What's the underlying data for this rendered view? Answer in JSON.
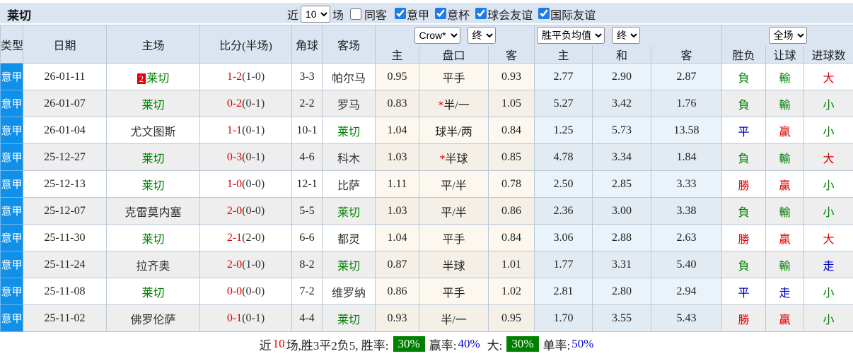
{
  "colors": {
    "red": "#dd0000",
    "green": "#008000",
    "blue": "#0000cc",
    "league_bg": "#1190ea",
    "header_bg": "#dbe5f1"
  },
  "topbar": {
    "team": "莱切",
    "near_label": "近",
    "near_count": "10",
    "games_label": "场",
    "same_away_label": "同客",
    "leagues": [
      {
        "label": "意甲",
        "checked": true
      },
      {
        "label": "意杯",
        "checked": true
      },
      {
        "label": "球会友谊",
        "checked": true
      },
      {
        "label": "国际友谊",
        "checked": true
      }
    ]
  },
  "header": {
    "cols": [
      "类型",
      "日期",
      "主场",
      "比分(半场)",
      "角球",
      "客场"
    ],
    "sub": [
      "主",
      "盘口",
      "客",
      "主",
      "和",
      "客",
      "胜负",
      "让球",
      "进球数"
    ],
    "selects": {
      "asia_company": "Crow*",
      "asia_time": "终",
      "europe_type": "胜平负均值",
      "europe_time": "终",
      "scope": "全场"
    }
  },
  "rows": [
    {
      "league": "意甲",
      "date": "26-01-11",
      "home": {
        "badge": "2",
        "name": "莱切",
        "lecce": true
      },
      "ft": "1-2",
      "ht": "(1-0)",
      "corner": "3-3",
      "away": {
        "name": "帕尔马",
        "lecce": false
      },
      "a_home": "0.95",
      "star": false,
      "hcap": "平手",
      "a_away": "0.93",
      "e_home": "2.77",
      "e_draw": "2.90",
      "e_away": "2.87",
      "outcome": {
        "t": "負",
        "c": "green"
      },
      "hres": {
        "t": "輸",
        "c": "green"
      },
      "goals": {
        "t": "大",
        "c": "red"
      }
    },
    {
      "league": "意甲",
      "date": "26-01-07",
      "home": {
        "badge": "",
        "name": "莱切",
        "lecce": true
      },
      "ft": "0-2",
      "ht": "(0-1)",
      "corner": "2-2",
      "away": {
        "name": "罗马",
        "lecce": false
      },
      "a_home": "0.83",
      "star": true,
      "hcap": "半/一",
      "a_away": "1.05",
      "e_home": "5.27",
      "e_draw": "3.42",
      "e_away": "1.76",
      "outcome": {
        "t": "負",
        "c": "green"
      },
      "hres": {
        "t": "輸",
        "c": "green"
      },
      "goals": {
        "t": "小",
        "c": "green"
      }
    },
    {
      "league": "意甲",
      "date": "26-01-04",
      "home": {
        "badge": "",
        "name": "尤文图斯",
        "lecce": false
      },
      "ft": "1-1",
      "ht": "(0-1)",
      "corner": "10-1",
      "away": {
        "name": "莱切",
        "lecce": true
      },
      "a_home": "1.04",
      "star": false,
      "hcap": "球半/两",
      "a_away": "0.84",
      "e_home": "1.25",
      "e_draw": "5.73",
      "e_away": "13.58",
      "outcome": {
        "t": "平",
        "c": "blue"
      },
      "hres": {
        "t": "贏",
        "c": "red"
      },
      "goals": {
        "t": "小",
        "c": "green"
      }
    },
    {
      "league": "意甲",
      "date": "25-12-27",
      "home": {
        "badge": "",
        "name": "莱切",
        "lecce": true
      },
      "ft": "0-3",
      "ht": "(0-1)",
      "corner": "4-6",
      "away": {
        "name": "科木",
        "lecce": false
      },
      "a_home": "1.03",
      "star": true,
      "hcap": "半球",
      "a_away": "0.85",
      "e_home": "4.78",
      "e_draw": "3.34",
      "e_away": "1.84",
      "outcome": {
        "t": "負",
        "c": "green"
      },
      "hres": {
        "t": "輸",
        "c": "green"
      },
      "goals": {
        "t": "大",
        "c": "red"
      }
    },
    {
      "league": "意甲",
      "date": "25-12-13",
      "home": {
        "badge": "",
        "name": "莱切",
        "lecce": true
      },
      "ft": "1-0",
      "ht": "(0-0)",
      "corner": "12-1",
      "away": {
        "name": "比萨",
        "lecce": false
      },
      "a_home": "1.11",
      "star": false,
      "hcap": "平/半",
      "a_away": "0.78",
      "e_home": "2.50",
      "e_draw": "2.85",
      "e_away": "3.33",
      "outcome": {
        "t": "勝",
        "c": "red"
      },
      "hres": {
        "t": "贏",
        "c": "red"
      },
      "goals": {
        "t": "小",
        "c": "green"
      }
    },
    {
      "league": "意甲",
      "date": "25-12-07",
      "home": {
        "badge": "",
        "name": "克雷莫内塞",
        "lecce": false
      },
      "ft": "2-0",
      "ht": "(0-0)",
      "corner": "5-5",
      "away": {
        "name": "莱切",
        "lecce": true
      },
      "a_home": "1.03",
      "star": false,
      "hcap": "平/半",
      "a_away": "0.86",
      "e_home": "2.36",
      "e_draw": "3.00",
      "e_away": "3.38",
      "outcome": {
        "t": "負",
        "c": "green"
      },
      "hres": {
        "t": "輸",
        "c": "green"
      },
      "goals": {
        "t": "小",
        "c": "green"
      }
    },
    {
      "league": "意甲",
      "date": "25-11-30",
      "home": {
        "badge": "",
        "name": "莱切",
        "lecce": true
      },
      "ft": "2-1",
      "ht": "(2-0)",
      "corner": "6-6",
      "away": {
        "name": "都灵",
        "lecce": false
      },
      "a_home": "1.04",
      "star": false,
      "hcap": "平手",
      "a_away": "0.84",
      "e_home": "3.06",
      "e_draw": "2.88",
      "e_away": "2.63",
      "outcome": {
        "t": "勝",
        "c": "red"
      },
      "hres": {
        "t": "贏",
        "c": "red"
      },
      "goals": {
        "t": "大",
        "c": "red"
      }
    },
    {
      "league": "意甲",
      "date": "25-11-24",
      "home": {
        "badge": "",
        "name": "拉齐奥",
        "lecce": false
      },
      "ft": "2-0",
      "ht": "(1-0)",
      "corner": "8-2",
      "away": {
        "name": "莱切",
        "lecce": true
      },
      "a_home": "0.87",
      "star": false,
      "hcap": "半球",
      "a_away": "1.01",
      "e_home": "1.77",
      "e_draw": "3.31",
      "e_away": "5.40",
      "outcome": {
        "t": "負",
        "c": "green"
      },
      "hres": {
        "t": "輸",
        "c": "green"
      },
      "goals": {
        "t": "走",
        "c": "blue"
      }
    },
    {
      "league": "意甲",
      "date": "25-11-08",
      "home": {
        "badge": "",
        "name": "莱切",
        "lecce": true
      },
      "ft": "0-0",
      "ht": "(0-0)",
      "corner": "7-2",
      "away": {
        "name": "维罗纳",
        "lecce": false
      },
      "a_home": "0.86",
      "star": false,
      "hcap": "平手",
      "a_away": "1.02",
      "e_home": "2.81",
      "e_draw": "2.80",
      "e_away": "2.94",
      "outcome": {
        "t": "平",
        "c": "blue"
      },
      "hres": {
        "t": "走",
        "c": "blue"
      },
      "goals": {
        "t": "小",
        "c": "green"
      }
    },
    {
      "league": "意甲",
      "date": "25-11-02",
      "home": {
        "badge": "",
        "name": "佛罗伦萨",
        "lecce": false
      },
      "ft": "0-1",
      "ht": "(0-1)",
      "corner": "4-4",
      "away": {
        "name": "莱切",
        "lecce": true
      },
      "a_home": "0.93",
      "star": false,
      "hcap": "半/一",
      "a_away": "0.95",
      "e_home": "1.70",
      "e_draw": "3.55",
      "e_away": "5.43",
      "outcome": {
        "t": "勝",
        "c": "red"
      },
      "hres": {
        "t": "贏",
        "c": "red"
      },
      "goals": {
        "t": "小",
        "c": "green"
      }
    }
  ],
  "summary": {
    "part1": "近",
    "num": "10",
    "part2": "场,胜3平2负5, 胜率:",
    "rate1": "30%",
    "part3": "赢率:",
    "rate2": "40%",
    "part4": "大:",
    "rate3": "30%",
    "part5": "单率:",
    "rate4": "50%"
  }
}
